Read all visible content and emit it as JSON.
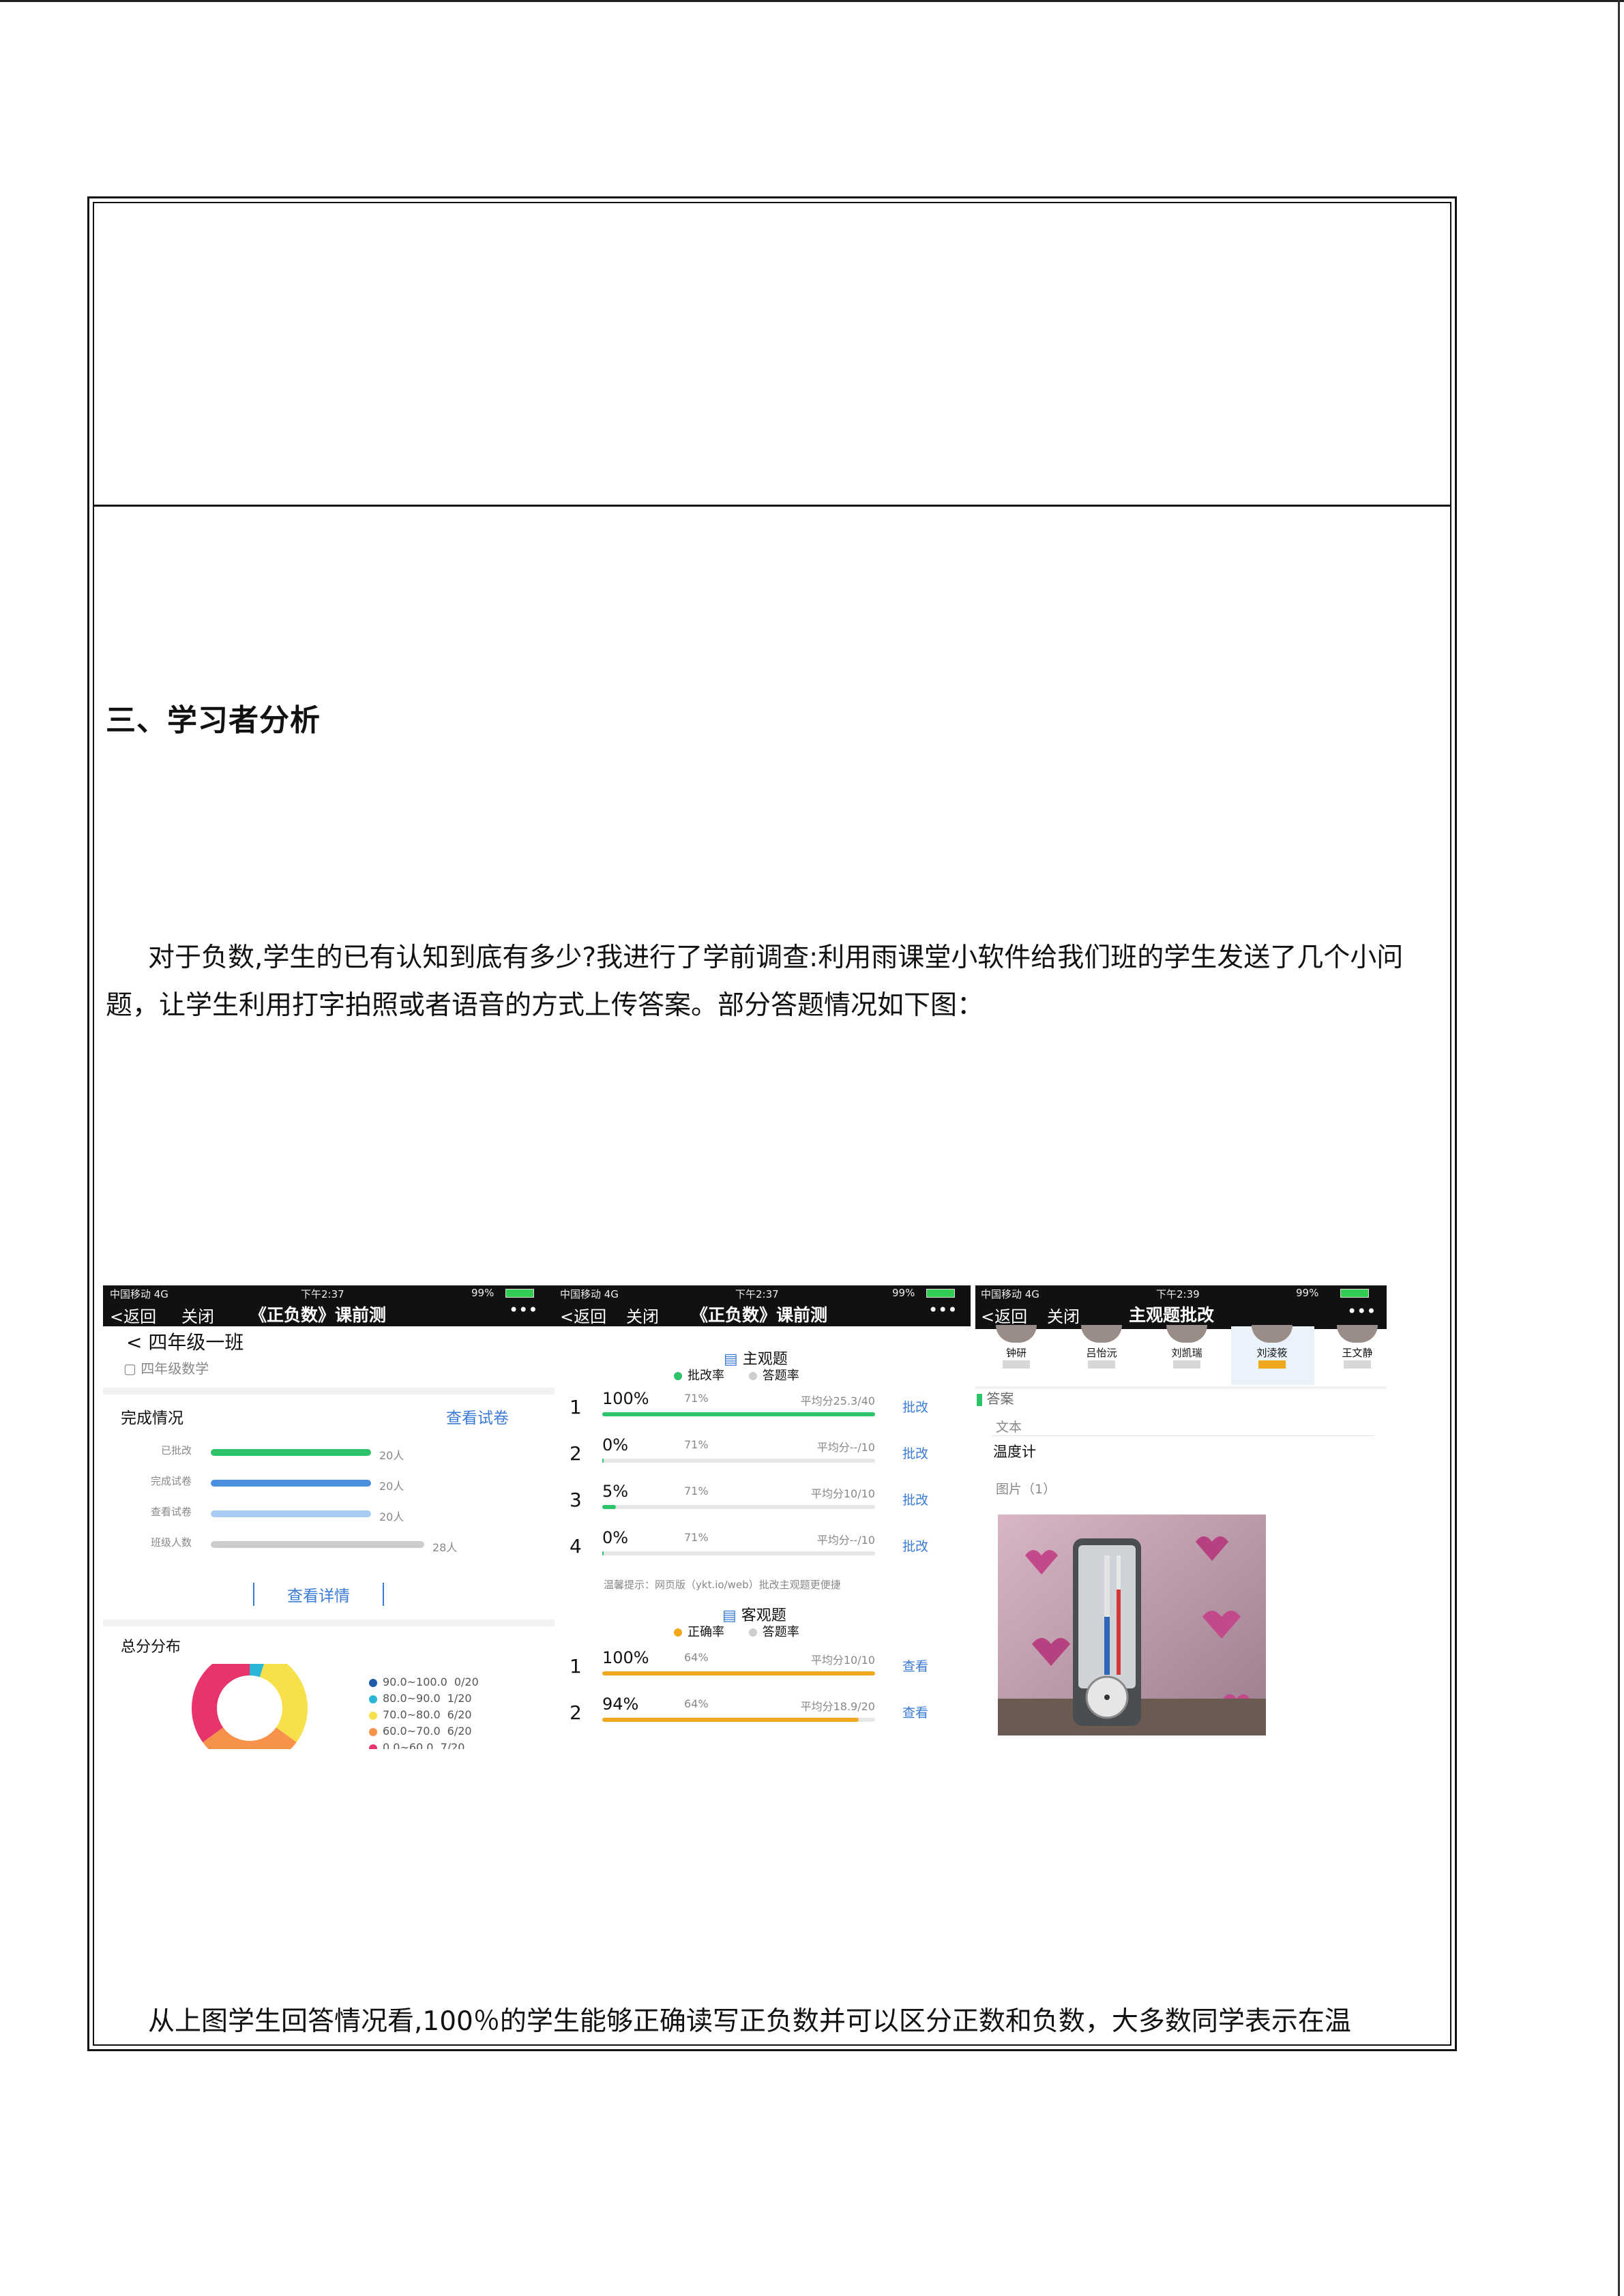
{
  "section": {
    "heading": "三、学习者分析",
    "para1": "对于负数,学生的已有认知到底有多少?我进行了学前调查:利用雨课堂小软件给我们班的学生发送了几个小问题，让学生利用打字拍照或者语音的方式上传答案。部分答题情况如下图：",
    "para2": "从上图学生回答情况看,100％的学生能够正确读写正负数并可以区分正数和负数，大多数同学表示在温"
  },
  "screen1": {
    "status": {
      "carrier": "中国移动  4G",
      "time": "下午2:37",
      "battery": "99%"
    },
    "nav": {
      "back": "返回",
      "close": "关闭",
      "title": "《正负数》课前测",
      "more": "•••"
    },
    "class_name": "四年级一班",
    "subject": "四年级数学",
    "completion_title": "完成情况",
    "view_paper": "查看试卷",
    "rows": [
      {
        "label": "已批改",
        "value": "20人",
        "pct": 0.69,
        "color": "#2ec36a"
      },
      {
        "label": "完成试卷",
        "value": "20人",
        "pct": 0.69,
        "color": "#4a8fe0"
      },
      {
        "label": "查看试卷",
        "value": "20人",
        "pct": 0.69,
        "color": "#a9ccf2"
      },
      {
        "label": "班级人数",
        "value": "28人",
        "pct": 0.92,
        "color": "#cccccc"
      }
    ],
    "view_detail": "查看详情",
    "dist_title": "总分分布",
    "legend": [
      {
        "range": "90.0~100.0",
        "count": "0/20",
        "color": "#1e5aa8"
      },
      {
        "range": "80.0~90.0",
        "count": "1/20",
        "color": "#29b6d8"
      },
      {
        "range": "70.0~80.0",
        "count": "6/20",
        "color": "#f8e04a"
      },
      {
        "range": "60.0~70.0",
        "count": "6/20",
        "color": "#f7924a"
      },
      {
        "range": "0.0~60.0",
        "count": "7/20",
        "color": "#e8336b"
      }
    ],
    "chart_data": {
      "type": "pie",
      "categories": [
        "90.0~100.0",
        "80.0~90.0",
        "70.0~80.0",
        "60.0~70.0",
        "0.0~60.0"
      ],
      "values": [
        0,
        1,
        6,
        6,
        7
      ],
      "colors": [
        "#1e5aa8",
        "#29b6d8",
        "#f8e04a",
        "#f7924a",
        "#e8336b"
      ],
      "title": "总分分布"
    }
  },
  "screen2": {
    "status": {
      "carrier": "中国移动  4G",
      "time": "下午2:37",
      "battery": "99%"
    },
    "nav": {
      "back": "返回",
      "close": "关闭",
      "title": "《正负数》课前测",
      "more": "•••"
    },
    "subjective_title": "主观题",
    "legend_a": "批改率",
    "legend_b": "答题率",
    "subjective": [
      {
        "num": "1",
        "pct": "100%",
        "rate": "71%",
        "avg": "平均分25.3/40",
        "action": "批改",
        "fill": 1.0
      },
      {
        "num": "2",
        "pct": "0%",
        "rate": "71%",
        "avg": "平均分--/10",
        "action": "批改",
        "fill": 0.0
      },
      {
        "num": "3",
        "pct": "5%",
        "rate": "71%",
        "avg": "平均分10/10",
        "action": "批改",
        "fill": 0.05
      },
      {
        "num": "4",
        "pct": "0%",
        "rate": "71%",
        "avg": "平均分--/10",
        "action": "批改",
        "fill": 0.0
      }
    ],
    "hint": "温馨提示：网页版（ykt.io/web）批改主观题更便捷",
    "objective_title": "客观题",
    "legend_c": "正确率",
    "legend_d": "答题率",
    "objective": [
      {
        "num": "1",
        "pct": "100%",
        "rate": "64%",
        "avg": "平均分10/10",
        "action": "查看",
        "fill": 1.0
      },
      {
        "num": "2",
        "pct": "94%",
        "rate": "64%",
        "avg": "平均分18.9/20",
        "action": "查看",
        "fill": 0.94
      }
    ]
  },
  "screen3": {
    "status": {
      "carrier": "中国移动  4G",
      "time": "下午2:39",
      "battery": "99%"
    },
    "nav": {
      "back": "返回",
      "close": "关闭",
      "title": "主观题批改",
      "more": "•••"
    },
    "students": [
      "钟研",
      "吕怡沅",
      "刘凯瑞",
      "刘淩筱",
      "王文静"
    ],
    "answer_label": "答案",
    "text_label": "文本",
    "answer_text": "温度计",
    "image_label": "图片（1）"
  }
}
